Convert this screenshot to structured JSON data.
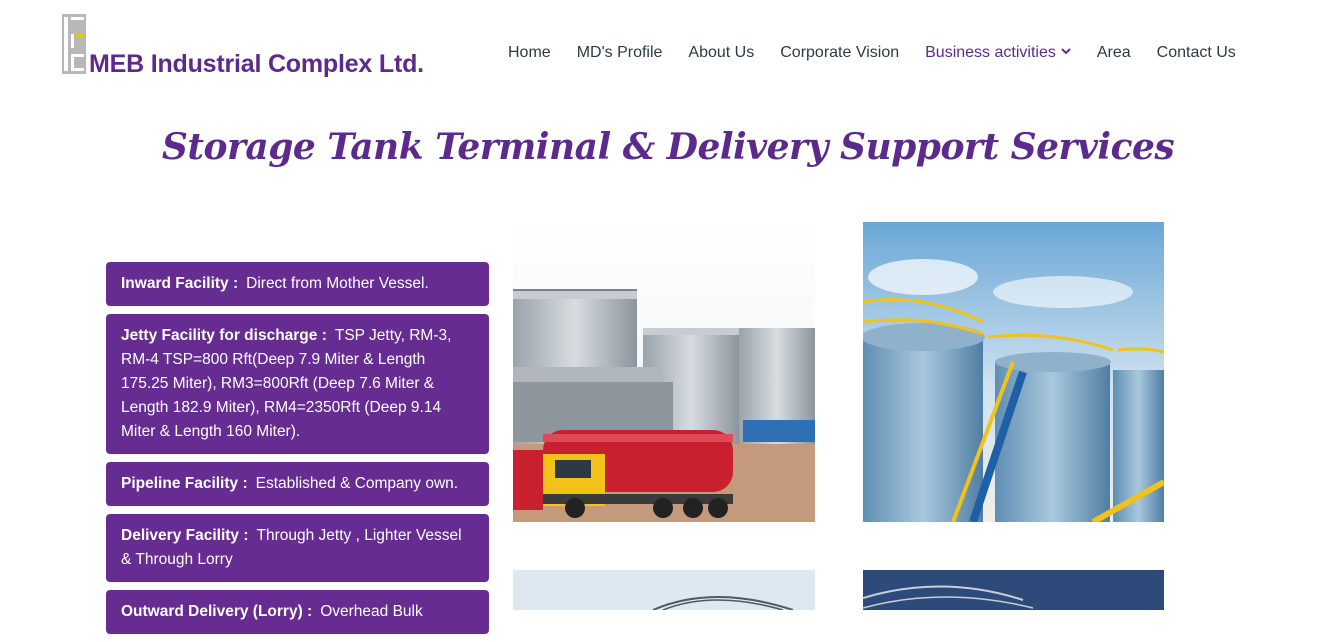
{
  "header": {
    "logo_text": "MEB Industrial Complex Ltd.",
    "nav": [
      {
        "label": "Home"
      },
      {
        "label": "MD's Profile"
      },
      {
        "label": "About Us"
      },
      {
        "label": "Corporate Vision"
      },
      {
        "label": "Business activities"
      },
      {
        "label": "Area"
      },
      {
        "label": "Contact Us"
      }
    ],
    "active_index": 4
  },
  "page": {
    "title": "Storage Tank Terminal & Delivery Support Services"
  },
  "facilities": [
    {
      "label": "Inward Facility :",
      "text": "Direct from Mother Vessel."
    },
    {
      "label": "Jetty Facility for discharge :",
      "text": "TSP Jetty, RM-3, RM-4 TSP=800 Rft(Deep 7.9 Miter & Length 175.25 Miter), RM3=800Rft (Deep 7.6 Miter & Length 182.9 Miter), RM4=2350Rft (Deep 9.14 Miter & Length 160 Miter)."
    },
    {
      "label": "Pipeline Facility :",
      "text": "Established & Company own."
    },
    {
      "label": "Delivery Facility :",
      "text": "Through Jetty , Lighter Vessel & Through Lorry"
    },
    {
      "label": "Outward Delivery (Lorry) :",
      "text": "Overhead Bulk"
    }
  ],
  "colors": {
    "brand": "#5c2a8c",
    "facility_bg": "#672c91",
    "nav_text": "#2d3b45"
  },
  "icons": {
    "logo": "meb-logo-mark",
    "nav_dropdown": "chevron-down-icon"
  }
}
